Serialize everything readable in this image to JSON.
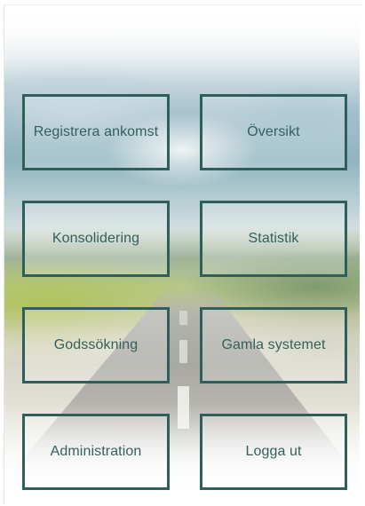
{
  "menu": {
    "tiles": [
      {
        "label": "Registrera ankomst"
      },
      {
        "label": "Översikt"
      },
      {
        "label": "Konsolidering"
      },
      {
        "label": "Statistik"
      },
      {
        "label": "Godssökning"
      },
      {
        "label": "Gamla systemet"
      },
      {
        "label": "Administration"
      },
      {
        "label": "Logga ut"
      }
    ]
  },
  "colors": {
    "tile_border": "#2f5f5b",
    "tile_text": "#34605c",
    "page_background": "#ffffff"
  }
}
